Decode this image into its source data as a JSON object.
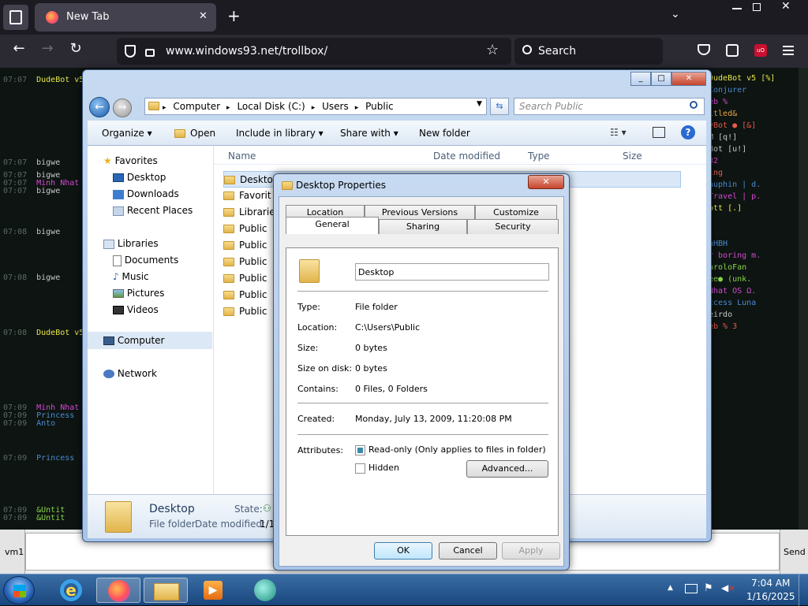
{
  "browser": {
    "tab_title": "New Tab",
    "tab_close": "✕",
    "new_tab": "+",
    "url": "www.windows93.net/trollbox/",
    "search_placeholder": "Search",
    "menu_icon": "hamburger-icon"
  },
  "trollbox": {
    "lines": [
      {
        "t": "07:07",
        "n": "DudeBot v5",
        "c": "#e8e84a"
      },
      {
        "t": "07:07",
        "n": "bigwe",
        "c": "#c8c8c8"
      },
      {
        "t": "07:07",
        "n": "bigwe",
        "c": "#c8c8c8"
      },
      {
        "t": "07:07",
        "n": "Minh Nhat",
        "c": "#d24ad2"
      },
      {
        "t": "07:07",
        "n": "bigwe",
        "c": "#c8c8c8"
      },
      {
        "t": "07:08",
        "n": "bigwe",
        "c": "#c8c8c8"
      },
      {
        "t": "07:08",
        "n": "bigwe",
        "c": "#c8c8c8"
      },
      {
        "t": "07:08",
        "n": "DudeBot v5",
        "c": "#e8e84a"
      },
      {
        "t": "07:09",
        "n": "Minh Nhat",
        "c": "#d24ad2"
      },
      {
        "t": "07:09",
        "n": "Princess",
        "c": "#4a8ad2"
      },
      {
        "t": "07:09",
        "n": "Anto",
        "c": "#4a8ad2"
      },
      {
        "t": "07:09",
        "n": "Princess",
        "c": "#4a8ad2"
      },
      {
        "t": "07:09",
        "n": "&Untit",
        "c": "#8ad24a"
      },
      {
        "t": "07:09",
        "n": "&Untit",
        "c": "#8ad24a"
      }
    ],
    "users": [
      {
        "n": "DudeBot v5 [%]",
        "c": "#e8e84a"
      },
      {
        "n": "Conjurer",
        "c": "#4a8ad2"
      },
      {
        "n": "eb %",
        "c": "#d24ad2"
      },
      {
        "n": "itled&",
        "c": "#e8a64a"
      },
      {
        "n": "yBot ● [&]",
        "c": "#e85a4a"
      },
      {
        "n": "M [q!]",
        "c": "#c8c8c8"
      },
      {
        "n": "Bot [u!]",
        "c": "#c8c8c8"
      },
      {
        "n": "32",
        "c": "#d24ad2"
      },
      {
        "n": "ing",
        "c": "#e85a4a"
      },
      {
        "n": "auphin | d.",
        "c": "#4a8ad2"
      },
      {
        "n": "Travel | p.",
        "c": "#d24ad2"
      },
      {
        "n": "ott [.]",
        "c": "#e8e84a"
      },
      {
        "n": "nHBH",
        "c": "#4a8ad2"
      },
      {
        "n": "r boring m.",
        "c": "#d24ad2"
      },
      {
        "n": "aroloFan",
        "c": "#8ad24a"
      },
      {
        "n": "ee● (unk.",
        "c": "#8ad24a"
      },
      {
        "n": "Nhat OS Ω.",
        "c": "#d24ad2"
      },
      {
        "n": "ccess Luna",
        "c": "#4a8ad2"
      },
      {
        "n": "eirdo",
        "c": "#c8c8c8"
      },
      {
        "n": "eb % 3",
        "c": "#e85a4a"
      }
    ],
    "input_left_label": "vm1",
    "send_label": "Send"
  },
  "explorer": {
    "breadcrumb": [
      "Computer",
      "Local Disk (C:)",
      "Users",
      "Public"
    ],
    "search_placeholder": "Search Public",
    "toolbar": {
      "organize": "Organize",
      "open": "Open",
      "include": "Include in library",
      "share": "Share with",
      "newfolder": "New folder"
    },
    "nav": {
      "favorites": "Favorites",
      "desktop": "Desktop",
      "downloads": "Downloads",
      "recent": "Recent Places",
      "libraries": "Libraries",
      "documents": "Documents",
      "music": "Music",
      "pictures": "Pictures",
      "videos": "Videos",
      "computer": "Computer",
      "network": "Network"
    },
    "columns": {
      "name": "Name",
      "date": "Date modified",
      "type": "Type",
      "size": "Size"
    },
    "items": [
      "Deskto",
      "Favorit",
      "Librarie",
      "Public",
      "Public",
      "Public",
      "Public",
      "Public",
      "Public"
    ],
    "details": {
      "name": "Desktop",
      "subtitle": "File folder",
      "state_label": "State:",
      "date_label": "Date modified:",
      "date_value": "1/1"
    }
  },
  "dialog": {
    "title": "Desktop Properties",
    "close": "✕",
    "tabs_row1": [
      "Location",
      "Previous Versions",
      "Customize"
    ],
    "tabs_row2": [
      "General",
      "Sharing",
      "Security"
    ],
    "name_value": "Desktop",
    "props": [
      {
        "label": "Type:",
        "value": "File folder"
      },
      {
        "label": "Location:",
        "value": "C:\\Users\\Public"
      },
      {
        "label": "Size:",
        "value": "0 bytes"
      },
      {
        "label": "Size on disk:",
        "value": "0 bytes"
      },
      {
        "label": "Contains:",
        "value": "0 Files, 0 Folders"
      }
    ],
    "created_label": "Created:",
    "created_value": "Monday, July 13, 2009, 11:20:08 PM",
    "attributes_label": "Attributes:",
    "readonly_label": "Read-only (Only applies to files in folder)",
    "hidden_label": "Hidden",
    "advanced_label": "Advanced...",
    "ok_label": "OK",
    "cancel_label": "Cancel",
    "apply_label": "Apply"
  },
  "taskbar": {
    "time": "7:04 AM",
    "date": "1/16/2025"
  }
}
